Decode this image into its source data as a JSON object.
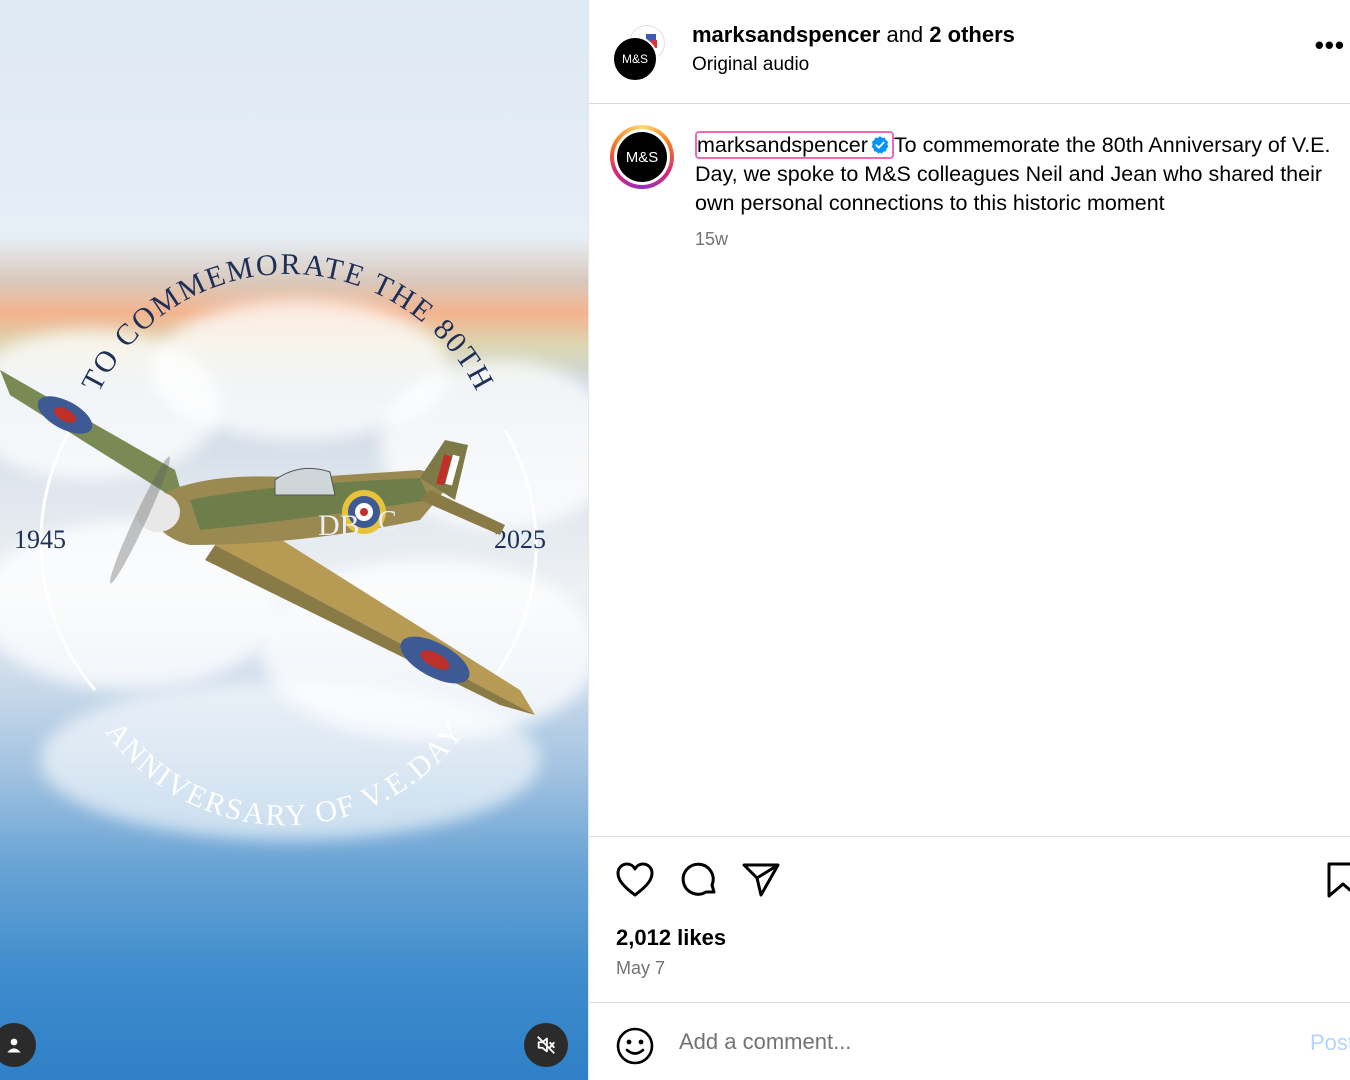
{
  "header": {
    "username": "marksandspencer",
    "joiner": "and",
    "others": "2 others",
    "audio": "Original audio",
    "avatar_text": "M&S"
  },
  "post_image": {
    "arc_top": "TO COMMEMORATE THE 80TH",
    "arc_bottom": "ANNIVERSARY OF V.E.DAY",
    "year_left": "1945",
    "year_right": "2025",
    "plane_code": "DB",
    "plane_letter": "C"
  },
  "caption": {
    "username": "marksandspencer",
    "avatar_text": "M&S",
    "text": "To commemorate the 80th Anniversary of V.E. Day, we spoke to M&S colleagues Neil and Jean who shared their own personal connections to this historic moment",
    "time_ago": "15w"
  },
  "stats": {
    "likes": "2,012 likes",
    "date": "May 7"
  },
  "comment": {
    "placeholder": "Add a comment...",
    "post_label": "Post"
  },
  "colors": {
    "username_highlight": "#ef6ab4",
    "verified_blue": "#0095f6",
    "post_disabled": "#b3d4fc"
  },
  "icons": [
    "user-tag-icon",
    "mute-icon",
    "more-icon",
    "heart-icon",
    "comment-icon",
    "share-icon",
    "bookmark-icon",
    "emoji-icon",
    "verified-icon"
  ]
}
